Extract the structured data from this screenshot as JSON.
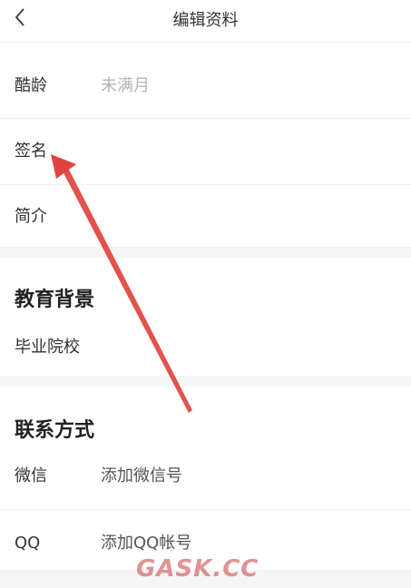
{
  "header": {
    "title": "编辑资料",
    "back_icon": "chevron-left-icon"
  },
  "profile": {
    "age": {
      "label": "酷龄",
      "value": "未满月"
    },
    "signature": {
      "label": "签名"
    },
    "intro": {
      "label": "简介"
    }
  },
  "education": {
    "title": "教育背景",
    "school": {
      "label": "毕业院校"
    }
  },
  "contact": {
    "title": "联系方式",
    "wechat": {
      "label": "微信",
      "value": "添加微信号"
    },
    "qq": {
      "label": "QQ",
      "value": "添加QQ帐号"
    }
  },
  "watermark": "GASK.CC",
  "colors": {
    "annotation_arrow": "#e0443e",
    "placeholder_text": "#b5b5b5",
    "section_gap": "#f5f5f5"
  }
}
